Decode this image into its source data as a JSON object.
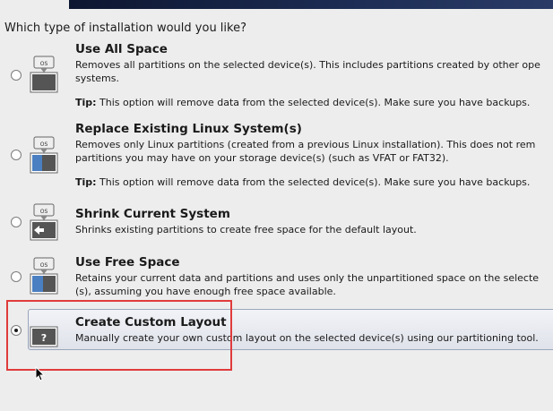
{
  "header": {
    "question": "Which type of installation would you like?"
  },
  "options": [
    {
      "title": "Use All Space",
      "desc1": "Removes all partitions on the selected device(s).  This includes partitions created by other ope",
      "desc2": "systems.",
      "tip_label": "Tip:",
      "tip_text": " This option will remove data from the selected device(s).  Make sure you have backups.",
      "icon": "os-drive-full-icon",
      "selected": false
    },
    {
      "title": "Replace Existing Linux System(s)",
      "desc1": "Removes only Linux partitions (created from a previous Linux installation).  This does not rem",
      "desc2": "partitions you may have on your storage device(s) (such as VFAT or FAT32).",
      "tip_label": "Tip:",
      "tip_text": " This option will remove data from the selected device(s).  Make sure you have backups.",
      "icon": "os-replace-icon",
      "selected": false
    },
    {
      "title": "Shrink Current System",
      "desc1": "Shrinks existing partitions to create free space for the default layout.",
      "icon": "os-shrink-icon",
      "selected": false
    },
    {
      "title": "Use Free Space",
      "desc1": "Retains your current data and partitions and uses only the unpartitioned space on the selecte",
      "desc2": "(s), assuming you have enough free space available.",
      "icon": "os-free-space-icon",
      "selected": false
    },
    {
      "title": "Create Custom Layout",
      "desc1": "Manually create your own custom layout on the selected device(s) using our partitioning tool.",
      "icon": "question-drive-icon",
      "selected": true
    }
  ],
  "icon_os_label": "OS",
  "icon_question_label": "?",
  "colors": {
    "highlight": "#e03b3b",
    "selection_border": "#9aa6bb",
    "drive_blue": "#4a7fc1"
  }
}
